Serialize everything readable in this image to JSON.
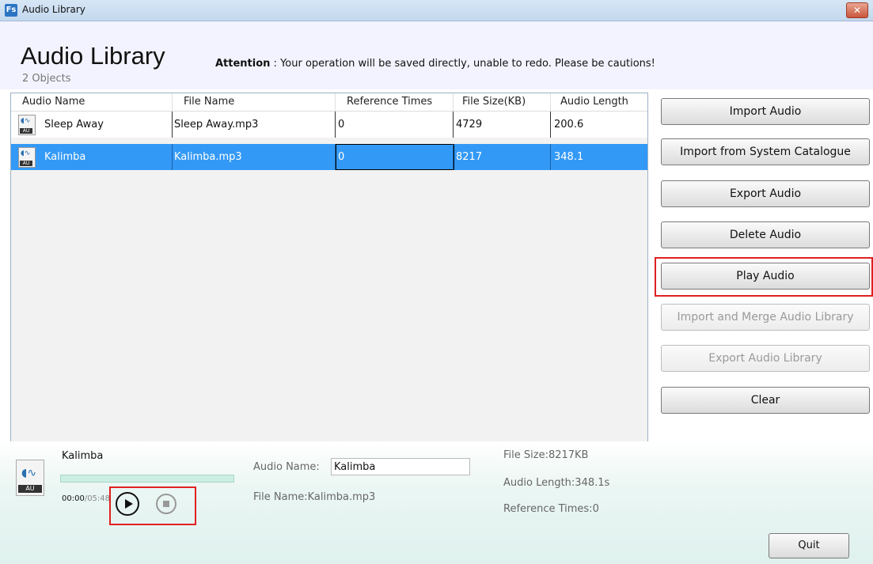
{
  "window": {
    "title": "Audio Library",
    "icon": "Fs",
    "close": "✕"
  },
  "header": {
    "title": "Audio Library",
    "attention_label": "Attention",
    "attention_text": " : Your operation will be saved directly, unable to redo. Please be cautions!",
    "object_count": "2 Objects"
  },
  "table": {
    "columns": [
      "Audio Name",
      "File Name",
      "Reference Times",
      "File Size(KB)",
      "Audio Length"
    ],
    "rows": [
      {
        "audio_name": "Sleep Away",
        "file_name": "Sleep Away.mp3",
        "reference_times": "0",
        "file_size": "4729",
        "audio_length": "200.6"
      },
      {
        "audio_name": "Kalimba",
        "file_name": "Kalimba.mp3",
        "reference_times": "0",
        "file_size": "8217",
        "audio_length": "348.1"
      }
    ],
    "selected_row": 1,
    "icon_label": "AU"
  },
  "buttons": {
    "import_audio": "Import Audio",
    "import_system": "Import from System Catalogue",
    "export_audio": "Export Audio",
    "delete_audio": "Delete Audio",
    "play_audio": "Play Audio",
    "import_merge": "Import and Merge Audio Library",
    "export_library": "Export Audio Library",
    "clear": "Clear"
  },
  "player": {
    "title": "Kalimba",
    "icon_label": "AU",
    "current_time": "00:00",
    "total_time": "/05:48",
    "progress": 0
  },
  "details": {
    "audio_name_label": "Audio Name:",
    "audio_name_value": "Kalimba",
    "file_name": "File Name:Kalimba.mp3",
    "file_size": "File Size:8217KB",
    "audio_length": "Audio Length:348.1s",
    "reference_times": "Reference Times:0"
  },
  "quit_label": "Quit",
  "colors": {
    "selection": "#3399f6",
    "highlight": "#e02020"
  }
}
